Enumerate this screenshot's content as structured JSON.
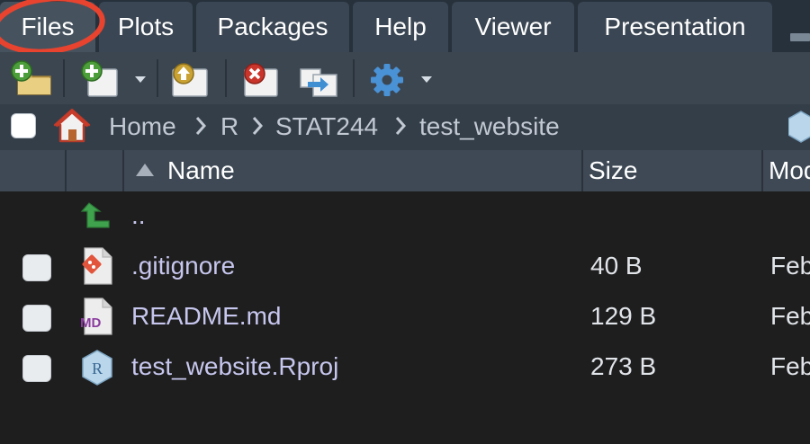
{
  "tabs": [
    {
      "label": "Files",
      "active": true
    },
    {
      "label": "Plots"
    },
    {
      "label": "Packages"
    },
    {
      "label": "Help"
    },
    {
      "label": "Viewer"
    },
    {
      "label": "Presentation"
    }
  ],
  "toolbar": {
    "icons": [
      "new-folder-icon",
      "new-file-icon",
      "upload-icon",
      "delete-icon",
      "rename-icon",
      "gear-icon"
    ]
  },
  "breadcrumb": {
    "items": [
      "Home",
      "R",
      "STAT244",
      "test_website"
    ]
  },
  "table": {
    "columns": {
      "name": "Name",
      "size": "Size",
      "modified": "Mod"
    }
  },
  "files": [
    {
      "name": "..",
      "size": "",
      "modified": "",
      "icon": "parent-folder-icon"
    },
    {
      "name": ".gitignore",
      "size": "40 B",
      "modified": "Feb",
      "icon": "git-file-icon"
    },
    {
      "name": "README.md",
      "size": "129 B",
      "modified": "Feb",
      "icon": "markdown-file-icon"
    },
    {
      "name": "test_website.Rproj",
      "size": "273 B",
      "modified": "Feb",
      "icon": "rproject-file-icon"
    }
  ],
  "colors": {
    "annotation": "#e8432e",
    "accent": "#3f8fd2"
  }
}
